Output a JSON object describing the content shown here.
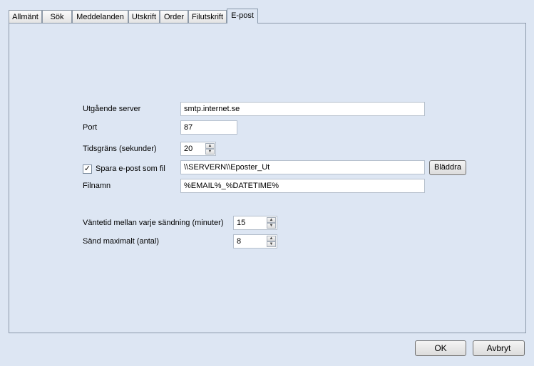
{
  "tabs": [
    {
      "label": "Allmänt"
    },
    {
      "label": "Sök"
    },
    {
      "label": "Meddelanden"
    },
    {
      "label": "Utskrift"
    },
    {
      "label": "Order"
    },
    {
      "label": "Filutskrift"
    },
    {
      "label": "E-post"
    }
  ],
  "active_tab": "E-post",
  "form": {
    "server_label": "Utgående server",
    "server_value": "smtp.internet.se",
    "port_label": "Port",
    "port_value": "87",
    "timeout_label": "Tidsgräns (sekunder)",
    "timeout_value": "20",
    "save_label": "Spara e-post som fil",
    "save_checked": "✓",
    "save_path": "\\\\SERVERN\\\\Eposter_Ut",
    "browse_label": "Bläddra",
    "filename_label": "Filnamn",
    "filename_value": "%EMAIL%_%DATETIME%",
    "wait_label": "Väntetid mellan varje sändning (minuter)",
    "wait_value": "15",
    "max_label": "Sänd maximalt (antal)",
    "max_value": "8"
  },
  "footer": {
    "ok_label": "OK",
    "cancel_label": "Avbryt"
  }
}
